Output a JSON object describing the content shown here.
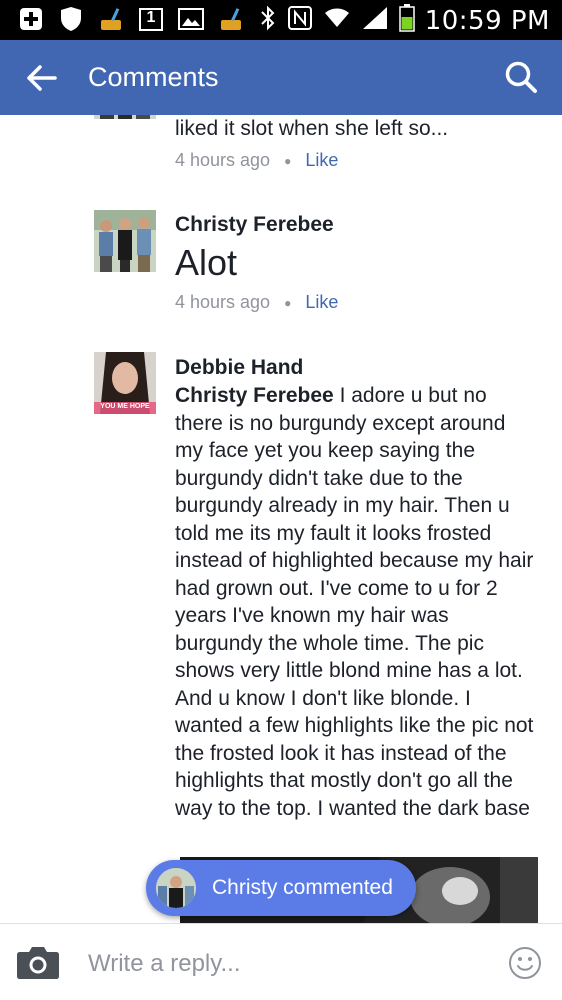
{
  "status_bar": {
    "time": "10:59 PM",
    "notification_icons": [
      "add-icon",
      "shield-icon",
      "cleaner-icon",
      "calendar-icon",
      "gallery-icon",
      "cleaner-icon"
    ],
    "calendar_day": "1",
    "system_icons": [
      "bluetooth-icon",
      "nfc-icon",
      "wifi-icon",
      "signal-icon",
      "battery-icon"
    ]
  },
  "app_bar": {
    "title": "Comments",
    "color": "#4267b2"
  },
  "comments": [
    {
      "name": "",
      "text": "liked it slot when she left so...",
      "time": "4 hours ago",
      "like": "Like"
    },
    {
      "name": "Christy Ferebee",
      "text": "Alot",
      "time": "4 hours ago",
      "like": "Like"
    },
    {
      "name": "Debbie Hand",
      "mention": "Christy Ferebee",
      "text": " I adore u but no there is no burgundy except around my face yet you keep saying the burgundy didn't take due to the burgundy already in my hair. Then u told me its my fault it looks frosted instead of highlighted because my hair had grown out. I've come to u for 2 years I've known my hair was burgundy the whole time. The pic shows very little blond mine has a lot. And u know I don't like blonde. I wanted a few highlights like the pic not the frosted look it has instead of the highlights that mostly don't go all the way to the top. I wanted the dark base",
      "avatar_caption": "YOU ME HOPE"
    }
  ],
  "toast": {
    "text": "Christy commented"
  },
  "composer": {
    "placeholder": "Write a reply..."
  }
}
